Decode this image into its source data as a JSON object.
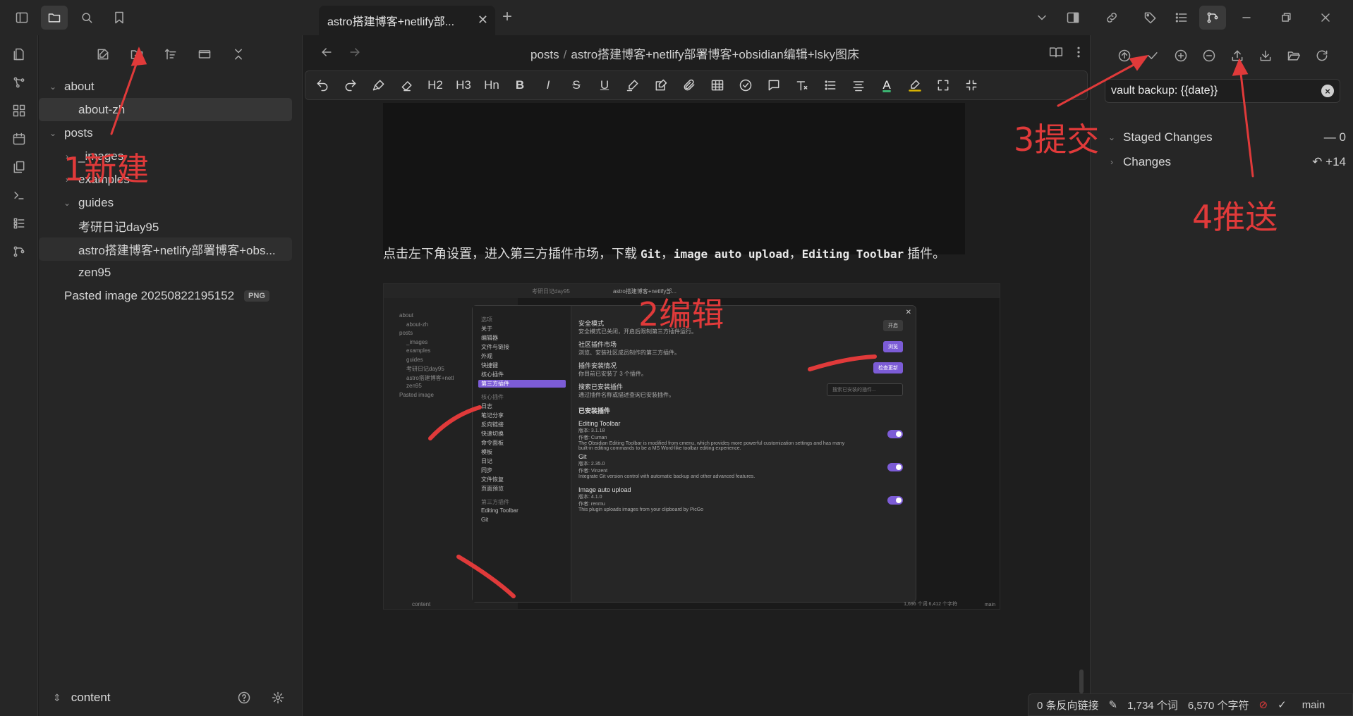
{
  "tab": {
    "title": "astro搭建博客+netlify部..."
  },
  "breadcrumb": {
    "folder": "posts",
    "sep": "/",
    "file": "astro搭建博客+netlify部署博客+obsidian编辑+lsky图床"
  },
  "tree": {
    "items": [
      {
        "label": "about",
        "level": 0,
        "chevron": "down"
      },
      {
        "label": "about-zh",
        "level": 1,
        "chevron": "",
        "state": "selected"
      },
      {
        "label": "posts",
        "level": 0,
        "chevron": "down"
      },
      {
        "label": "_images",
        "level": 1,
        "chevron": "right"
      },
      {
        "label": "examples",
        "level": 1,
        "chevron": "right"
      },
      {
        "label": "guides",
        "level": 1,
        "chevron": "down"
      },
      {
        "label": "考研日记day95",
        "level": 1,
        "chevron": ""
      },
      {
        "label": "astro搭建博客+netlify部署博客+obs...",
        "level": 1,
        "chevron": "",
        "state": "active"
      },
      {
        "label": "zen95",
        "level": 1,
        "chevron": ""
      },
      {
        "label": "Pasted image 20250822195152",
        "level": 0,
        "chevron": "",
        "badge": "PNG"
      }
    ]
  },
  "vault": {
    "name": "content"
  },
  "toolbar": {
    "h2": "H2",
    "h3": "H3",
    "hn": "Hn",
    "bold": "B",
    "italic": "I",
    "strike": "S",
    "underline": "U",
    "color_a": "A"
  },
  "paragraph": {
    "prefix": "点击左下角设置，进入第三方插件市场，下载 ",
    "code1": "Git",
    "sep1": "，",
    "code2": "image auto upload",
    "sep2": "，",
    "code3": "Editing Toolbar",
    "suffix": " 插件。"
  },
  "embed": {
    "tree": [
      "about",
      "about-zh",
      "posts",
      "_images",
      "examples",
      "guides",
      "考研日记day95",
      "astro搭建博客+netl",
      "zen95",
      "Pasted image"
    ],
    "nav_options": [
      "选项",
      "关于",
      "编辑器",
      "文件与链接",
      "外观",
      "快捷键",
      "核心插件",
      "第三方插件"
    ],
    "nav_core": [
      "核心插件",
      "日志",
      "笔记分享",
      "反向链接",
      "快速切换",
      "命令面板",
      "模板",
      "日记",
      "同步",
      "文件恢复",
      "页面预览"
    ],
    "nav_third": [
      "第三方插件",
      "Editing Toolbar",
      "Git"
    ],
    "safe_mode": {
      "title": "安全模式",
      "desc": "安全模式已关闭，开启后限制第三方插件运行。",
      "button": "开启"
    },
    "market": {
      "title": "社区插件市场",
      "desc": "浏览、安装社区成员制作的第三方插件。",
      "button": "浏览"
    },
    "updates": {
      "title": "插件安装情况",
      "desc": "你目前已安装了 3 个插件。",
      "button": "检查更新"
    },
    "search": {
      "title": "搜索已安装插件",
      "desc": "通过插件名称或描述查询已安装插件。",
      "placeholder": "搜索已安装的插件..."
    },
    "installed_heading": "已安装插件",
    "plugins": [
      {
        "name": "Editing Toolbar",
        "version": "版本: 3.1.18",
        "author": "作者: Cuman",
        "desc": "The Obsidian Editing Toolbar is modified from cmenu, which provides more powerful customization settings and has many built-in editing commands to be a MS Word-like toolbar editing experience."
      },
      {
        "name": "Git",
        "version": "版本: 2.35.0",
        "author": "作者: Vinzent",
        "desc": "Integrate Git version control with automatic backup and other advanced features."
      },
      {
        "name": "Image auto upload",
        "version": "版本: 4.1.0",
        "author": "作者: renmu",
        "desc": "This plugin uploads images from your clipboard by PicGo"
      }
    ],
    "status": "content",
    "status_right": "1,696 个词  6,412 个字符",
    "branch": "main",
    "bg_tab1": "考研日记day95",
    "bg_tab2": "astro搭建博客+netlify部..."
  },
  "git": {
    "commit_message": "vault backup: {{date}}",
    "staged_label": "Staged Changes",
    "staged_count": "0",
    "changes_label": "Changes",
    "changes_count": "14"
  },
  "status": {
    "backlinks": "0 条反向链接",
    "words": "1,734 个词",
    "chars": "6,570 个字符",
    "branch": "main"
  },
  "annotations": {
    "new": "1新建",
    "edit": "2编辑",
    "commit": "3提交",
    "push": "4推送"
  },
  "colors": {
    "accent": "#7c5cd6",
    "annotation": "#e03a3a",
    "background": "#1e1e1e",
    "panel": "#262626"
  },
  "icons": {
    "ribbon": [
      "files-icon",
      "graph-icon",
      "canvas-icon",
      "calendar-icon",
      "templates-icon",
      "terminal-icon",
      "list-icon",
      "git-icon"
    ],
    "git_toolbar": [
      "push-circle-icon",
      "check-icon",
      "plus-circle-icon",
      "minus-circle-icon",
      "upload-icon",
      "download-icon",
      "folder-icon",
      "refresh-icon"
    ]
  }
}
